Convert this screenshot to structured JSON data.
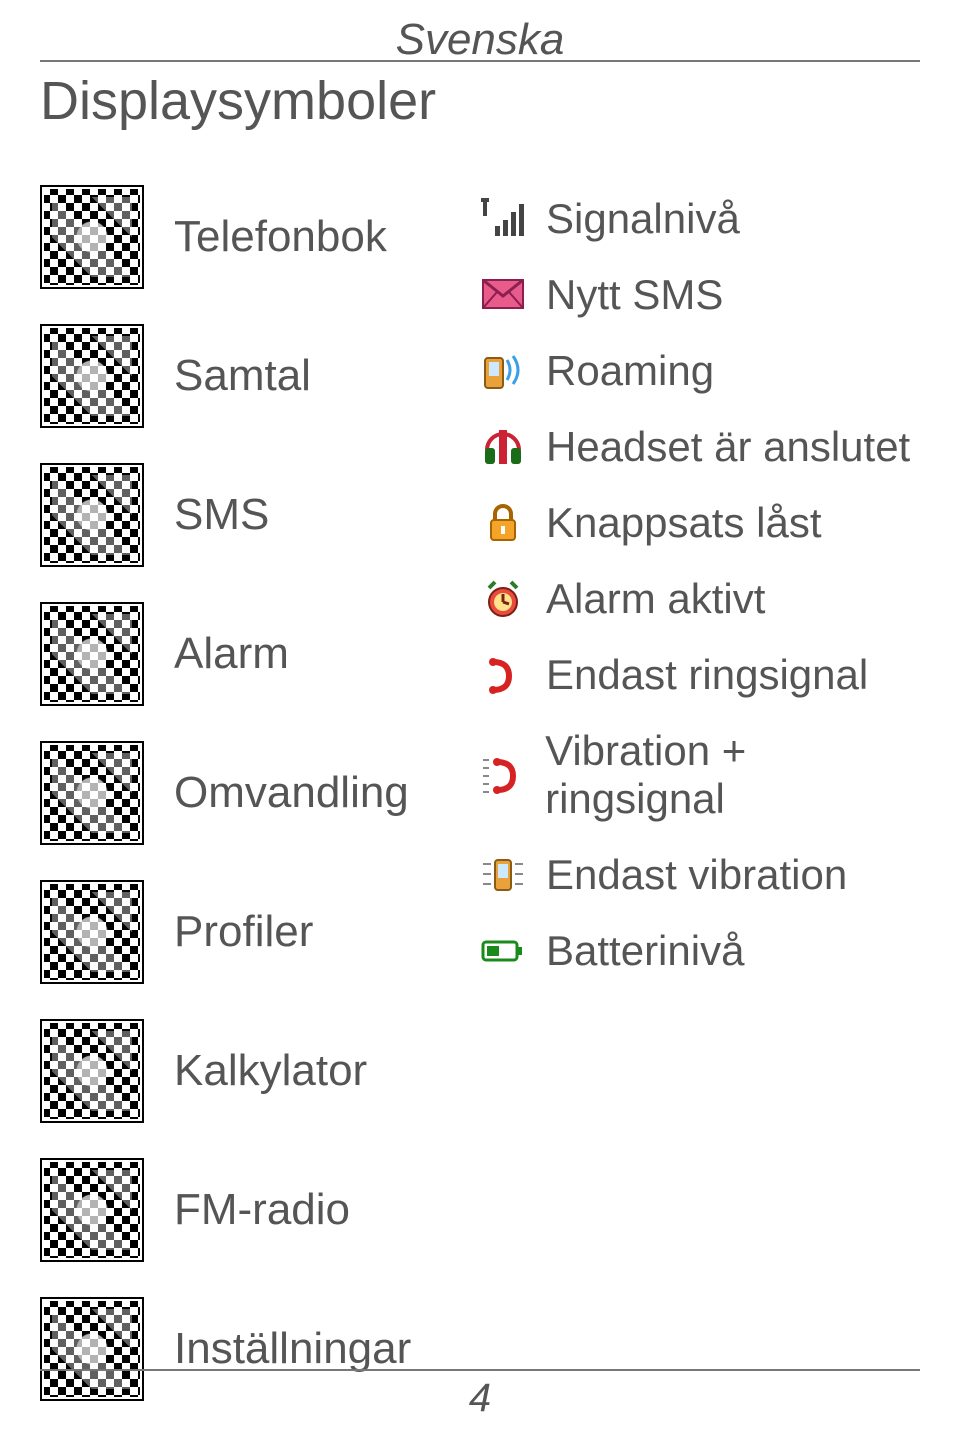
{
  "header": {
    "language": "Svenska",
    "title": "Displaysymboler"
  },
  "left_items": [
    {
      "name": "phonebook-icon",
      "label": "Telefonbok"
    },
    {
      "name": "calls-icon",
      "label": "Samtal"
    },
    {
      "name": "sms-icon",
      "label": "SMS"
    },
    {
      "name": "alarm-icon",
      "label": "Alarm"
    },
    {
      "name": "converter-icon",
      "label": "Omvandling"
    },
    {
      "name": "profiles-icon",
      "label": "Profiler"
    },
    {
      "name": "calculator-icon",
      "label": "Kalkylator"
    },
    {
      "name": "fmradio-icon",
      "label": "FM-radio"
    },
    {
      "name": "settings-icon",
      "label": "Inställningar"
    }
  ],
  "right_items": [
    {
      "name": "signal-icon",
      "label": "Signalnivå"
    },
    {
      "name": "newsms-icon",
      "label": "Nytt SMS"
    },
    {
      "name": "roaming-icon",
      "label": "Roaming"
    },
    {
      "name": "headset-icon",
      "label": "Headset är anslutet"
    },
    {
      "name": "keypad-lock-icon",
      "label": "Knappsats låst"
    },
    {
      "name": "alarm-active-icon",
      "label": "Alarm aktivt"
    },
    {
      "name": "ring-only-icon",
      "label": "Endast ringsignal"
    },
    {
      "name": "vibrate-ring-icon",
      "label": "Vibration + ringsignal"
    },
    {
      "name": "vibrate-only-icon",
      "label": "Endast vibration"
    },
    {
      "name": "battery-icon",
      "label": "Batterinivå"
    }
  ],
  "footer": {
    "page": "4"
  }
}
